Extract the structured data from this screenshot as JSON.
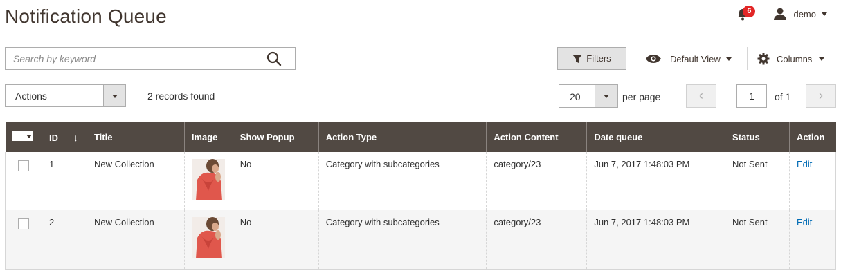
{
  "page": {
    "title": "Notification Queue"
  },
  "header": {
    "notification_count": "6",
    "user_name": "demo"
  },
  "toolbar": {
    "search_placeholder": "Search by keyword",
    "filters_label": "Filters",
    "view_label": "Default View",
    "columns_label": "Columns",
    "actions_label": "Actions",
    "records_found": "2 records found",
    "per_page_value": "20",
    "per_page_label": "per page",
    "page_current": "1",
    "page_total": "of 1"
  },
  "table": {
    "columns": {
      "id": "ID",
      "title": "Title",
      "image": "Image",
      "show_popup": "Show Popup",
      "action_type": "Action Type",
      "action_content": "Action Content",
      "date_queue": "Date queue",
      "status": "Status",
      "action": "Action"
    },
    "rows": [
      {
        "id": "1",
        "title": "New Collection",
        "show_popup": "No",
        "action_type": "Category with subcategories",
        "action_content": "category/23",
        "date_queue": "Jun 7, 2017 1:48:03 PM",
        "status": "Not Sent",
        "action": "Edit"
      },
      {
        "id": "2",
        "title": "New Collection",
        "show_popup": "No",
        "action_type": "Category with subcategories",
        "action_content": "category/23",
        "date_queue": "Jun 7, 2017 1:48:03 PM",
        "status": "Not Sent",
        "action": "Edit"
      }
    ]
  },
  "icons": {
    "bell": "bell-icon",
    "user": "user-icon",
    "search": "search-icon",
    "filter": "filter-icon",
    "eye": "eye-icon",
    "gear": "gear-icon"
  },
  "colors": {
    "header_bg": "#514943",
    "badge": "#e22626",
    "link": "#006bb4"
  }
}
